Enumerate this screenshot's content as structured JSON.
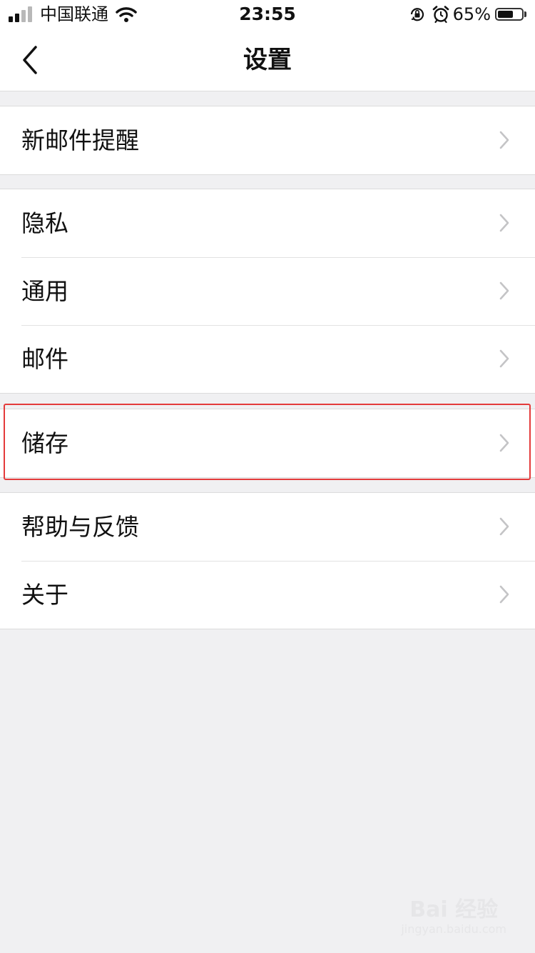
{
  "status_bar": {
    "carrier": "中国联通",
    "time": "23:55",
    "battery_percent": "65%",
    "battery_level": 0.65,
    "icons": [
      "signal-icon",
      "wifi-icon",
      "orientation-lock-icon",
      "alarm-icon",
      "battery-icon"
    ]
  },
  "nav": {
    "title": "设置",
    "back_icon": "chevron-left-icon"
  },
  "groups": [
    {
      "items": [
        {
          "label": "新邮件提醒"
        }
      ]
    },
    {
      "items": [
        {
          "label": "隐私"
        },
        {
          "label": "通用"
        },
        {
          "label": "邮件"
        }
      ]
    },
    {
      "items": [
        {
          "label": "储存",
          "highlighted": true
        }
      ]
    },
    {
      "items": [
        {
          "label": "帮助与反馈"
        },
        {
          "label": "关于"
        }
      ]
    }
  ],
  "watermark": {
    "logo_text": "Bai 经验",
    "sub_text": "jingyan.baidu.com"
  },
  "colors": {
    "background": "#f0f0f2",
    "row_background": "#ffffff",
    "highlight_border": "#e43b3b",
    "chevron": "#c4c4c6",
    "text": "#111111"
  }
}
